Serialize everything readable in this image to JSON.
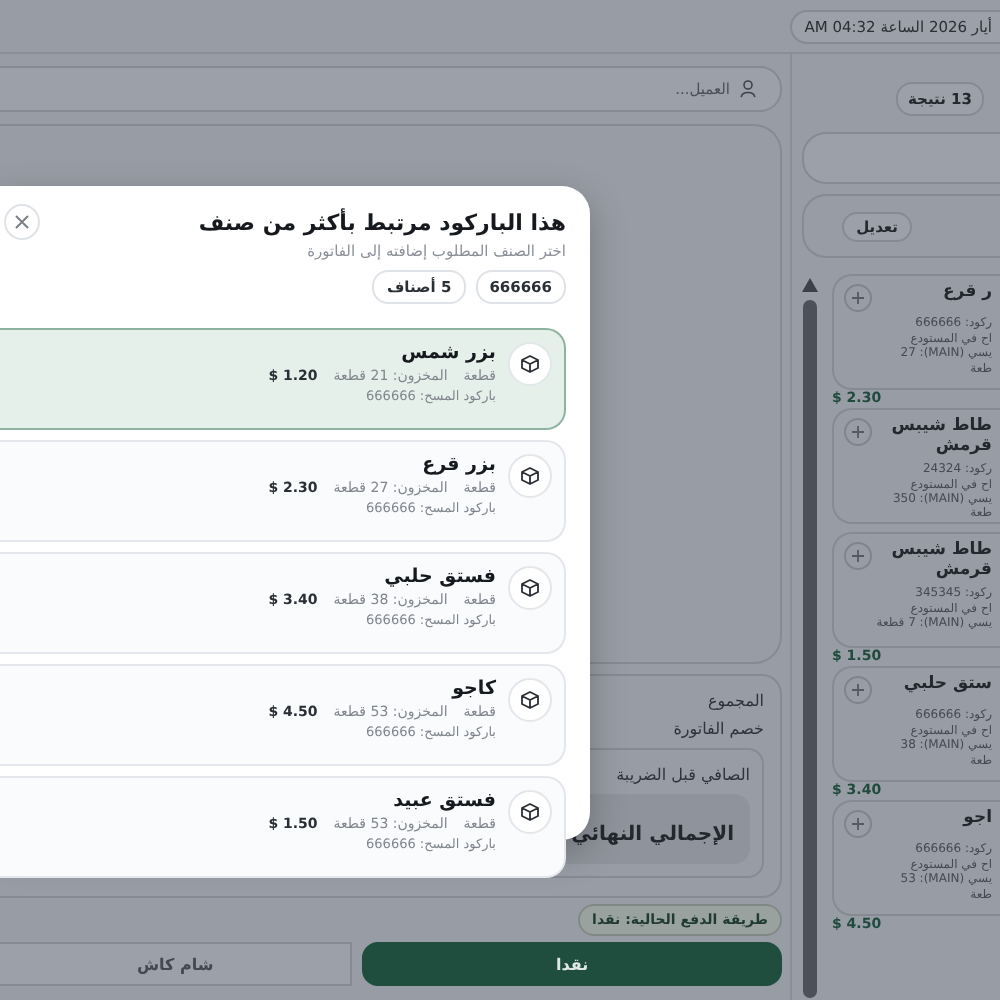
{
  "header": {
    "datetime": "أيار 2026 الساعة 04:32 AM"
  },
  "customer_field": {
    "placeholder": "العميل..."
  },
  "totals": {
    "subtotal_label": "المجموع",
    "discount_label": "خصم الفاتورة",
    "net_label": "الصافي قبل الضريبة",
    "grand_total_label": "الإجمالي النهائي"
  },
  "payment": {
    "current": "طريقة الدفع الحالية: نقدا",
    "methods": [
      {
        "label": "نقدا",
        "selected": true
      },
      {
        "label": "شام كاش",
        "selected": false
      }
    ]
  },
  "results": {
    "count": "13 نتيجة",
    "edit_button": "تعديل",
    "products": [
      {
        "name_lines": [
          "ر قرع"
        ],
        "barcode": "ركود: 666666",
        "stock_lines": [
          "اح في المستودع",
          "يسي (MAIN): 27",
          "طعة"
        ],
        "price": "$ 2.30"
      },
      {
        "name_lines": [
          "طاط شيبس",
          "قرمش"
        ],
        "barcode": "ركود: 24324",
        "stock_lines": [
          "اح في المستودع",
          "يسي (MAIN): 350",
          "طعة"
        ]
      },
      {
        "name_lines": [
          "طاط شيبس",
          "قرمش"
        ],
        "barcode": "ركود: 345345",
        "stock_lines": [
          "اح في المستودع",
          "يسي (MAIN): 7 قطعة"
        ],
        "price": "$ 1.50"
      },
      {
        "name_lines": [
          "ستق حلبي"
        ],
        "barcode": "ركود: 666666",
        "stock_lines": [
          "اح في المستودع",
          "يسي (MAIN): 38",
          "طعة"
        ],
        "price": "$ 3.40"
      },
      {
        "name_lines": [
          "اجو"
        ],
        "barcode": "ركود: 666666",
        "stock_lines": [
          "اح في المستودع",
          "يسي (MAIN): 53",
          "طعة"
        ],
        "price": "$ 4.50"
      }
    ]
  },
  "dialog": {
    "title": "هذا الباركود مرتبط بأكثر من صنف",
    "subtitle": "اختر الصنف المطلوب إضافته إلى الفاتورة",
    "chips": [
      "666666",
      "5 أصناف"
    ],
    "items": [
      {
        "name": "بزر شمس",
        "unit": "قطعة",
        "stock": "المخزون: 21 قطعة",
        "price": "$ 1.20",
        "barcode": "باركود المسح: 666666",
        "selected": true
      },
      {
        "name": "بزر قرع",
        "unit": "قطعة",
        "stock": "المخزون: 27 قطعة",
        "price": "$ 2.30",
        "barcode": "باركود المسح: 666666",
        "selected": false
      },
      {
        "name": "فستق حلبي",
        "unit": "قطعة",
        "stock": "المخزون: 38 قطعة",
        "price": "$ 3.40",
        "barcode": "باركود المسح: 666666",
        "selected": false
      },
      {
        "name": "كاجو",
        "unit": "قطعة",
        "stock": "المخزون: 53 قطعة",
        "price": "$ 4.50",
        "barcode": "باركود المسح: 666666",
        "selected": false
      },
      {
        "name": "فستق عبيد",
        "unit": "قطعة",
        "stock": "المخزون: 53 قطعة",
        "price": "$ 1.50",
        "barcode": "باركود المسح: 666666",
        "selected": false
      }
    ]
  }
}
